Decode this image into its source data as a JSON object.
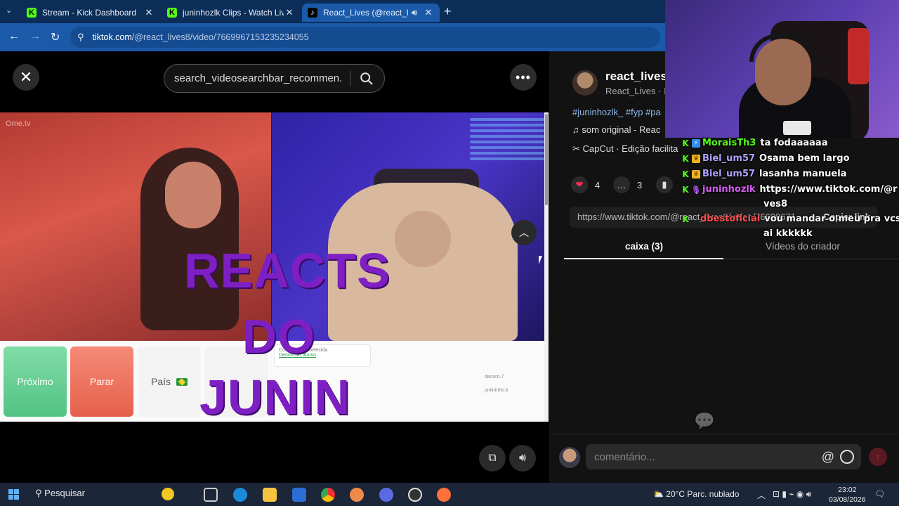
{
  "browser": {
    "tabs": [
      {
        "label": "Stream - Kick Dashboard",
        "icon": "kick-icon"
      },
      {
        "label": "juninhozlk Clips - Watch Live o",
        "icon": "kick-icon"
      },
      {
        "label": "React_Lives (@react_lives8)",
        "icon": "tiktok-icon"
      }
    ],
    "url_domain": "tiktok.com",
    "url_path": "/@react_lives8/video/7669967153235234055"
  },
  "tiktok": {
    "search_placeholder": "search_videosearchbar_recommen...",
    "video": {
      "brand": "Ome.tv",
      "overlay_line1": "REACTS",
      "overlay_line2": "DO",
      "overlay_line3": "JUNIN",
      "btn_next": "Próximo",
      "btn_stop": "Parar",
      "btn_country": "País",
      "status_line1": "Conexão estabelecida",
      "status_link": "Denunciar abuso",
      "side_1": "decoro.7",
      "side_2": "junininho.k"
    },
    "profile": {
      "username": "react_lives",
      "fullname": "React_Lives · I",
      "tags": "#juninhozlk_ #fyp #pa",
      "music": "som original - Reac",
      "capcut": "CapCut · Edição facilita"
    },
    "actions": {
      "likes": "4",
      "comments": "3"
    },
    "copy": {
      "link": "https://www.tiktok.com/@react_lives8/video/76699671",
      "button": "Copiar link"
    },
    "tabs": {
      "comments": "caixa (3)",
      "creator_videos": "Vídeos do criador"
    },
    "comment_placeholder": "comentário..."
  },
  "stream_chat": [
    {
      "user": "MoraisTh3",
      "msg": "ta fodaaaaaa",
      "color": "#53fc18",
      "badges": [
        "k",
        "b"
      ]
    },
    {
      "user": "Biel_um57",
      "msg": "Osama bem largo",
      "color": "#b3a0ff",
      "badges": [
        "k",
        "o"
      ]
    },
    {
      "user": "Biel_um57",
      "msg": "lasanha manuela",
      "color": "#b3a0ff",
      "badges": [
        "k",
        "o"
      ]
    },
    {
      "user": "juninhozlk",
      "msg": "https://www.tiktok.com/@r",
      "msg2": "ves8",
      "color": "#d65cf5",
      "badges": [
        "k",
        "p"
      ]
    },
    {
      "user": "dbestoficial",
      "msg": "vou mandar o meu pra vcs r",
      "msg2": "ai kkkkkk",
      "color": "#ff4f4f",
      "badges": [
        "k"
      ]
    }
  ],
  "taskbar": {
    "search": "Pesquisar",
    "weather": "20°C  Parc. nublado",
    "time": "23:02",
    "date": "03/08/2026"
  }
}
